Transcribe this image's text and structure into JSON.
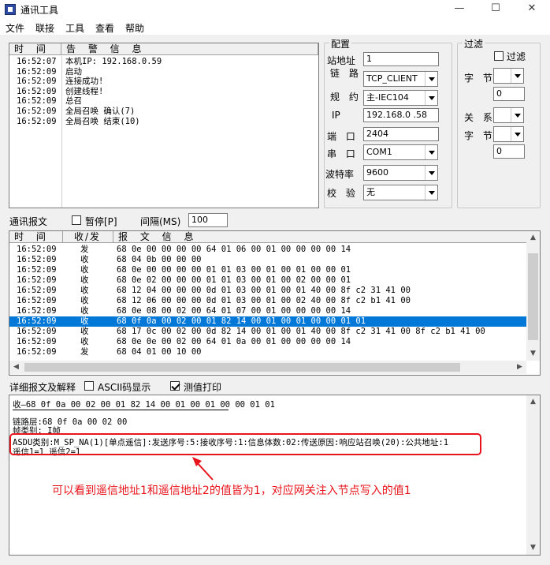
{
  "window": {
    "title": "通讯工具",
    "minimize": "—",
    "maximize": "☐",
    "close": "✕"
  },
  "menu": [
    "文件",
    "联接",
    "工具",
    "查看",
    "帮助"
  ],
  "alarm": {
    "headers": [
      "时 间",
      "告 警  信 息"
    ],
    "rows": [
      [
        "16:52:07",
        "本机IP: 192.168.0.59"
      ],
      [
        "16:52:09",
        "启动"
      ],
      [
        "16:52:09",
        "连接成功!"
      ],
      [
        "16:52:09",
        "创建线程!"
      ],
      [
        "16:52:09",
        "总召"
      ],
      [
        "16:52:09",
        "全局召唤 确认(7)"
      ],
      [
        "16:52:09",
        "全局召唤 结束(10)"
      ]
    ]
  },
  "config": {
    "title": "配置",
    "station_label": "站地址",
    "station_value": "1",
    "link_label": "链 路",
    "link_value": "TCP_CLIENT",
    "protocol_label": "规 约",
    "protocol_value": "主-IEC104",
    "ip_label": "IP",
    "ip_value": "192.168.0 .58",
    "port_label": "端 口",
    "port_value": "2404",
    "serial_label": "串 口",
    "serial_value": "COM1",
    "baud_label": "波特率",
    "baud_value": "9600",
    "check_label": "校 验",
    "check_value": "无"
  },
  "filter": {
    "title": "过滤",
    "enable_label": "过滤",
    "byte1_label": "字 节",
    "byte1_value": "",
    "value1": "0",
    "relation_label": "关 系",
    "relation_value": "",
    "byte2_label": "字 节",
    "byte2_value": "",
    "value2": "0"
  },
  "comm": {
    "label": "通讯报文",
    "pause_label": "暂停[P]",
    "interval_label": "间隔(MS)",
    "interval_value": "100"
  },
  "messages": {
    "headers": [
      "时 间",
      "收/发",
      "报 文  信 息"
    ],
    "selected_index": 7,
    "rows": [
      [
        "16:52:09",
        "发",
        "68 0e 00 00 00 00 64 01 06 00 01 00 00 00 00 14"
      ],
      [
        "16:52:09",
        "收",
        "68 04 0b 00 00 00"
      ],
      [
        "16:52:09",
        "收",
        "68 0e 00 00 00 00 01 01 03 00 01 00 01 00 00 01"
      ],
      [
        "16:52:09",
        "收",
        "68 0e 02 00 00 00 01 01 03 00 01 00 02 00 00 01"
      ],
      [
        "16:52:09",
        "收",
        "68 12 04 00 00 00 0d 01 03 00 01 00 01 40 00 8f c2 31 41 00"
      ],
      [
        "16:52:09",
        "收",
        "68 12 06 00 00 00 0d 01 03 00 01 00 02 40 00 8f c2 b1 41 00"
      ],
      [
        "16:52:09",
        "收",
        "68 0e 08 00 02 00 64 01 07 00 01 00 00 00 00 14"
      ],
      [
        "16:52:09",
        "收",
        "68 0f 0a 00 02 00 01 82 14 00 01 00 01 00 00 01 01"
      ],
      [
        "16:52:09",
        "收",
        "68 17 0c 00 02 00 0d 82 14 00 01 00 01 40 00 8f c2 31 41 00 8f c2 b1 41 00"
      ],
      [
        "16:52:09",
        "收",
        "68 0e 0e 00 02 00 64 01 0a 00 01 00 00 00 00 14"
      ],
      [
        "16:52:09",
        "发",
        "68 04 01 00 10 00"
      ]
    ]
  },
  "detail": {
    "label": "详细报文及解释",
    "ascii_label": "ASCII码显示",
    "ascii_checked": false,
    "measure_label": "测值打印",
    "measure_checked": true,
    "lines": [
      "收—68 0f 0a 00 02 00 01 82 14 00 01 00 01 00 00 01 01",
      "链路层:68 0f 0a 00 02 00",
      "帧类别: I帧",
      "ASDU类别:M_SP_NA(1)[单点遥信]:发送序号:5:接收序号:1:信息体数:02:传送原因:响应站召唤(20):公共地址:1",
      "  遥信1=1  遥信2=1"
    ],
    "annotation": "可以看到遥信地址1和遥信地址2的值皆为1，对应网关注入节点写入的值1"
  },
  "colors": {
    "selection": "#0078d7",
    "annotation": "#e8141c"
  }
}
